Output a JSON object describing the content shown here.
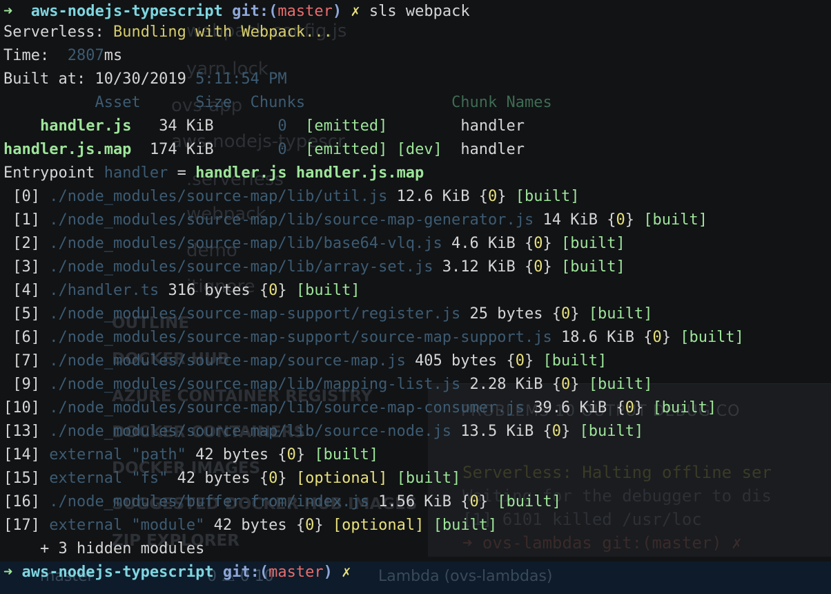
{
  "background_ghost": {
    "tabs": "PROBLEMS   10   OUTPUT   DEBUG CO",
    "sidebar_items": [
      "webpack.config.js",
      "yarn.lock",
      "ovs-app",
      "aws-nodejs-typescr",
      ".serverless",
      "webpack",
      "demo",
      "itignore"
    ],
    "sidebar_sections": [
      "OUTLINE",
      "DOCKER HUB",
      "AZURE CONTAINER REGISTRY",
      "DOCKER CONTAINERS",
      "DOCKER IMAGES",
      "SUGGESTED DOCKER HUB IMAGES",
      "ZIP EXPLORER"
    ],
    "panel_lines": [
      "Serverless: Halting offline ser",
      "Waiting for the debugger to dis",
      "[1]    6101 killed     /usr/loc",
      "➜  ovs-lambdas git:(master) ✗"
    ],
    "status_bar": {
      "branch": "master",
      "problems": "0  ⚠ 0  10",
      "lambda": "Lambda (ovs-lambdas)"
    }
  },
  "terminal": {
    "prompt_arrow": "➜",
    "cwd": "aws-nodejs-typescript",
    "git_prefix": "git:(",
    "branch": "master",
    "git_suffix": ")",
    "dirty": "✗",
    "command": "sls webpack",
    "serverless_label": "Serverless:",
    "serverless_msg": "Bundling with Webpack...",
    "time_label": "Time:",
    "time_value": "2807",
    "time_unit": "ms",
    "built_label": "Built at:",
    "built_date": "10/30/2019",
    "built_time": "5:11:54 PM",
    "asset_headers": {
      "asset": "Asset",
      "size": "Size",
      "chunks": "Chunks",
      "chunk_names": "Chunk Names"
    },
    "assets": [
      {
        "name": "handler.js",
        "size": "34 KiB",
        "chunks": "0",
        "flags": "[emitted]",
        "chunk_name": "handler"
      },
      {
        "name": "handler.js.map",
        "size": "174 KiB",
        "chunks": "0",
        "flags": "[emitted] [dev]",
        "chunk_name": "handler"
      }
    ],
    "entrypoint_label": "Entrypoint",
    "entrypoint_name": "handler",
    "entrypoint_eq": "=",
    "entrypoint_files": "handler.js handler.js.map",
    "modules": [
      {
        "id": "[0]",
        "path": "./node_modules/source-map/lib/util.js",
        "size": "12.6 KiB",
        "optional": "",
        "built": "[built]"
      },
      {
        "id": "[1]",
        "path": "./node_modules/source-map/lib/source-map-generator.js",
        "size": "14 KiB",
        "optional": "",
        "built": "[built]"
      },
      {
        "id": "[2]",
        "path": "./node_modules/source-map/lib/base64-vlq.js",
        "size": "4.6 KiB",
        "optional": "",
        "built": "[built]"
      },
      {
        "id": "[3]",
        "path": "./node_modules/source-map/lib/array-set.js",
        "size": "3.12 KiB",
        "optional": "",
        "built": "[built]"
      },
      {
        "id": "[4]",
        "path": "./handler.ts",
        "size": "316 bytes",
        "optional": "",
        "built": "[built]"
      },
      {
        "id": "[5]",
        "path": "./node_modules/source-map-support/register.js",
        "size": "25 bytes",
        "optional": "",
        "built": "[built]"
      },
      {
        "id": "[6]",
        "path": "./node_modules/source-map-support/source-map-support.js",
        "size": "18.6 KiB",
        "optional": "",
        "built": "[built]"
      },
      {
        "id": "[7]",
        "path": "./node_modules/source-map/source-map.js",
        "size": "405 bytes",
        "optional": "",
        "built": "[built]"
      },
      {
        "id": "[9]",
        "path": "./node_modules/source-map/lib/mapping-list.js",
        "size": "2.28 KiB",
        "optional": "",
        "built": "[built]"
      },
      {
        "id": "[10]",
        "path": "./node_modules/source-map/lib/source-map-consumer.js",
        "size": "39.6 KiB",
        "optional": "",
        "built": "[built]"
      },
      {
        "id": "[13]",
        "path": "./node_modules/source-map/lib/source-node.js",
        "size": "13.5 KiB",
        "optional": "",
        "built": "[built]"
      },
      {
        "id": "[14]",
        "path": "external \"path\"",
        "size": "42 bytes",
        "optional": "",
        "built": "[built]"
      },
      {
        "id": "[15]",
        "path": "external \"fs\"",
        "size": "42 bytes",
        "optional": "[optional]",
        "built": "[built]"
      },
      {
        "id": "[16]",
        "path": "./node_modules/buffer-from/index.js",
        "size": "1.56 KiB",
        "optional": "",
        "built": "[built]"
      },
      {
        "id": "[17]",
        "path": "external \"module\"",
        "size": "42 bytes",
        "optional": "[optional]",
        "built": "[built]"
      }
    ],
    "chunk_id": "0",
    "hidden_modules": "+ 3 hidden modules"
  },
  "colors": {
    "background": "#111315",
    "text": "#d6d6d6",
    "green": "#9ee59a",
    "yellow": "#e8e07c",
    "cyan": "#7fd6e0",
    "red": "#e86d6d",
    "dim_path": "#3d5b72"
  }
}
